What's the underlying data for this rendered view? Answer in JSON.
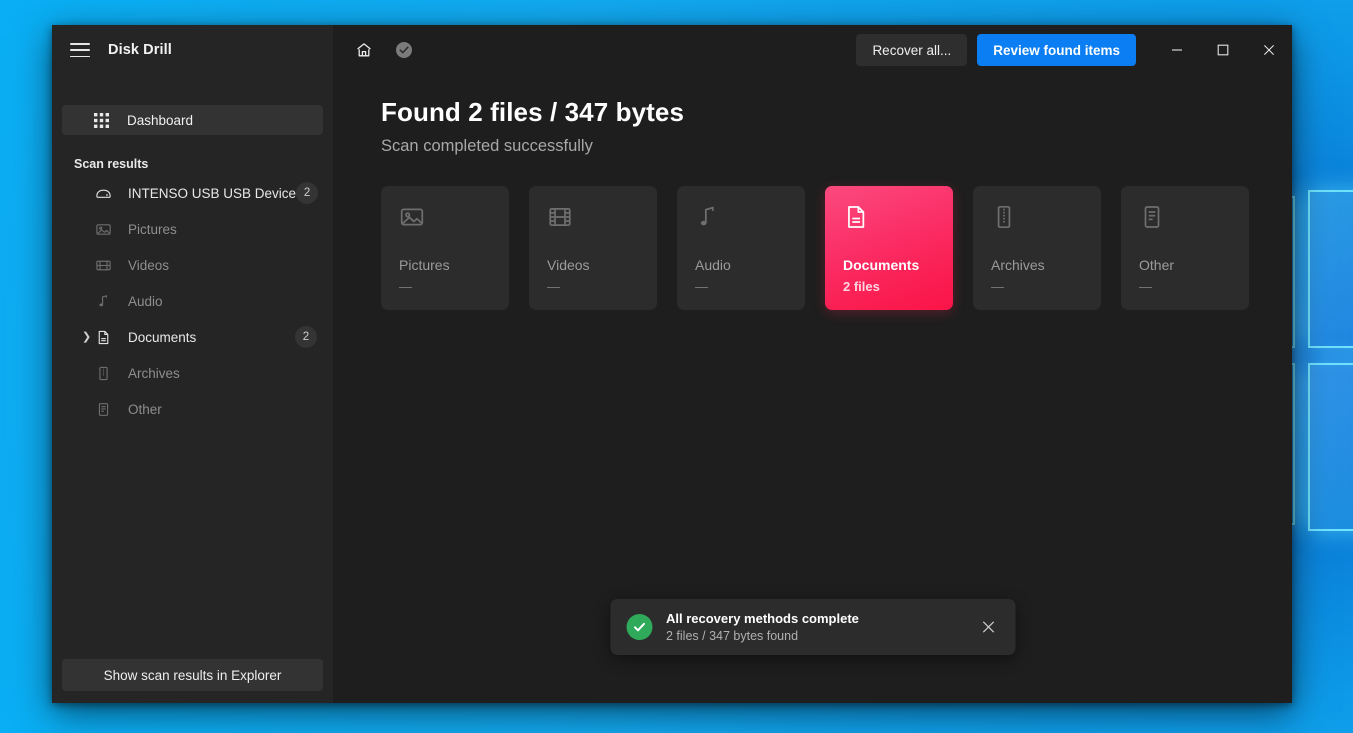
{
  "window": {
    "app_title": "Disk Drill",
    "minimize_label": "Minimize",
    "maximize_label": "Maximize",
    "close_label": "Close"
  },
  "sidebar": {
    "dashboard": {
      "label": "Dashboard",
      "icon": "grid-icon"
    },
    "section_label": "Scan results",
    "items": [
      {
        "label": "INTENSO USB USB Device",
        "icon": "disk-icon",
        "badge": "2",
        "expandable": false,
        "highlight": true
      },
      {
        "label": "Pictures",
        "icon": "picture-icon",
        "badge": "",
        "expandable": false,
        "highlight": false
      },
      {
        "label": "Videos",
        "icon": "video-icon",
        "badge": "",
        "expandable": false,
        "highlight": false
      },
      {
        "label": "Audio",
        "icon": "audio-icon",
        "badge": "",
        "expandable": false,
        "highlight": false
      },
      {
        "label": "Documents",
        "icon": "document-icon",
        "badge": "2",
        "expandable": true,
        "highlight": true
      },
      {
        "label": "Archives",
        "icon": "archive-icon",
        "badge": "",
        "expandable": false,
        "highlight": false
      },
      {
        "label": "Other",
        "icon": "other-icon",
        "badge": "",
        "expandable": false,
        "highlight": false
      }
    ],
    "explorer_button": "Show scan results in Explorer"
  },
  "toolbar": {
    "home_icon": "home-icon",
    "status_icon": "check-circle-icon",
    "recover_all_label": "Recover all...",
    "review_found_label": "Review found items",
    "accent_color": "#0b7ef4"
  },
  "content": {
    "heading": "Found 2 files / 347 bytes",
    "subheading": "Scan completed successfully",
    "cards": [
      {
        "title": "Pictures",
        "sub": "—",
        "icon": "picture-icon",
        "selected": false
      },
      {
        "title": "Videos",
        "sub": "—",
        "icon": "video-icon",
        "selected": false
      },
      {
        "title": "Audio",
        "sub": "—",
        "icon": "audio-icon",
        "selected": false
      },
      {
        "title": "Documents",
        "sub": "2 files",
        "icon": "document-icon",
        "selected": true
      },
      {
        "title": "Archives",
        "sub": "—",
        "icon": "archive-icon",
        "selected": false
      },
      {
        "title": "Other",
        "sub": "—",
        "icon": "other-icon",
        "selected": false
      }
    ],
    "selected_card_color": "#fb2f68"
  },
  "toast": {
    "title": "All recovery methods complete",
    "subtitle": "2 files / 347 bytes found",
    "status_color": "#2eaa5a",
    "close_label": "Dismiss"
  }
}
